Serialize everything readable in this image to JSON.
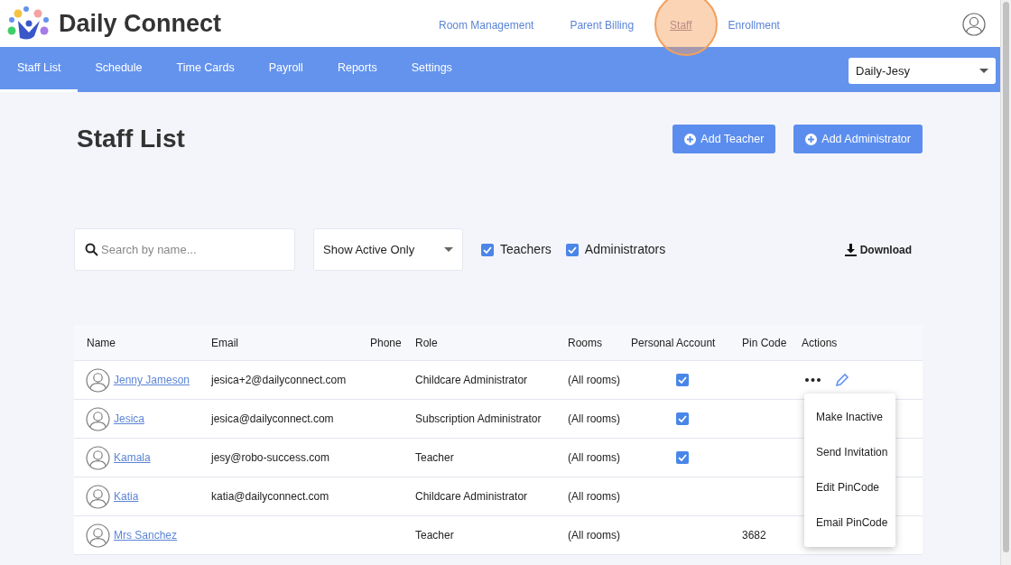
{
  "brand": {
    "name": "Daily Connect"
  },
  "top_nav": [
    {
      "label": "Room Management",
      "selected": false
    },
    {
      "label": "Parent Billing",
      "selected": false
    },
    {
      "label": "Staff",
      "selected": true
    },
    {
      "label": "Enrollment",
      "selected": false
    }
  ],
  "tabs": [
    {
      "label": "Staff List",
      "selected": true
    },
    {
      "label": "Schedule",
      "selected": false
    },
    {
      "label": "Time Cards",
      "selected": false
    },
    {
      "label": "Payroll",
      "selected": false
    },
    {
      "label": "Reports",
      "selected": false
    },
    {
      "label": "Settings",
      "selected": false
    }
  ],
  "account_select": {
    "value": "Daily-Jesy"
  },
  "page_title": "Staff List",
  "buttons": [
    {
      "label": "Add Teacher"
    },
    {
      "label": "Add Administrator"
    }
  ],
  "filters": {
    "search": {
      "placeholder": "Search by name..."
    },
    "status_select": {
      "value": "Show Active Only"
    },
    "checkboxes": [
      {
        "label": "Teachers",
        "checked": true
      },
      {
        "label": "Administrators",
        "checked": true
      }
    ],
    "download": "Download"
  },
  "table": {
    "columns": [
      "Name",
      "Email",
      "Phone",
      "Role",
      "Rooms",
      "Personal Account",
      "Pin Code",
      "Actions"
    ],
    "rows": [
      {
        "name": "Jenny Jameson",
        "email": "jesica+2@dailyconnect.com",
        "role": "Childcare Administrator",
        "rooms": "(All rooms)",
        "personal_account": true
      },
      {
        "name": "Jesica",
        "email": "jesica@dailyconnect.com",
        "role": "Subscription Administrator",
        "rooms": "(All rooms)",
        "personal_account": true
      },
      {
        "name": "Kamala",
        "email": "jesy@robo-success.com",
        "role": "Teacher",
        "rooms": "(All rooms)",
        "personal_account": true
      },
      {
        "name": "Katia",
        "email": "katia@dailyconnect.com",
        "role": "Childcare Administrator",
        "rooms": "(All rooms)",
        "personal_account": false
      },
      {
        "name": "Mrs Sanchez",
        "role": "Teacher",
        "rooms": "(All rooms)",
        "personal_account": false,
        "pin_code": "3682"
      }
    ]
  },
  "actions_menu": {
    "items": [
      "Make Inactive",
      "Send Invitation",
      "Edit PinCode",
      "Email PinCode"
    ]
  }
}
